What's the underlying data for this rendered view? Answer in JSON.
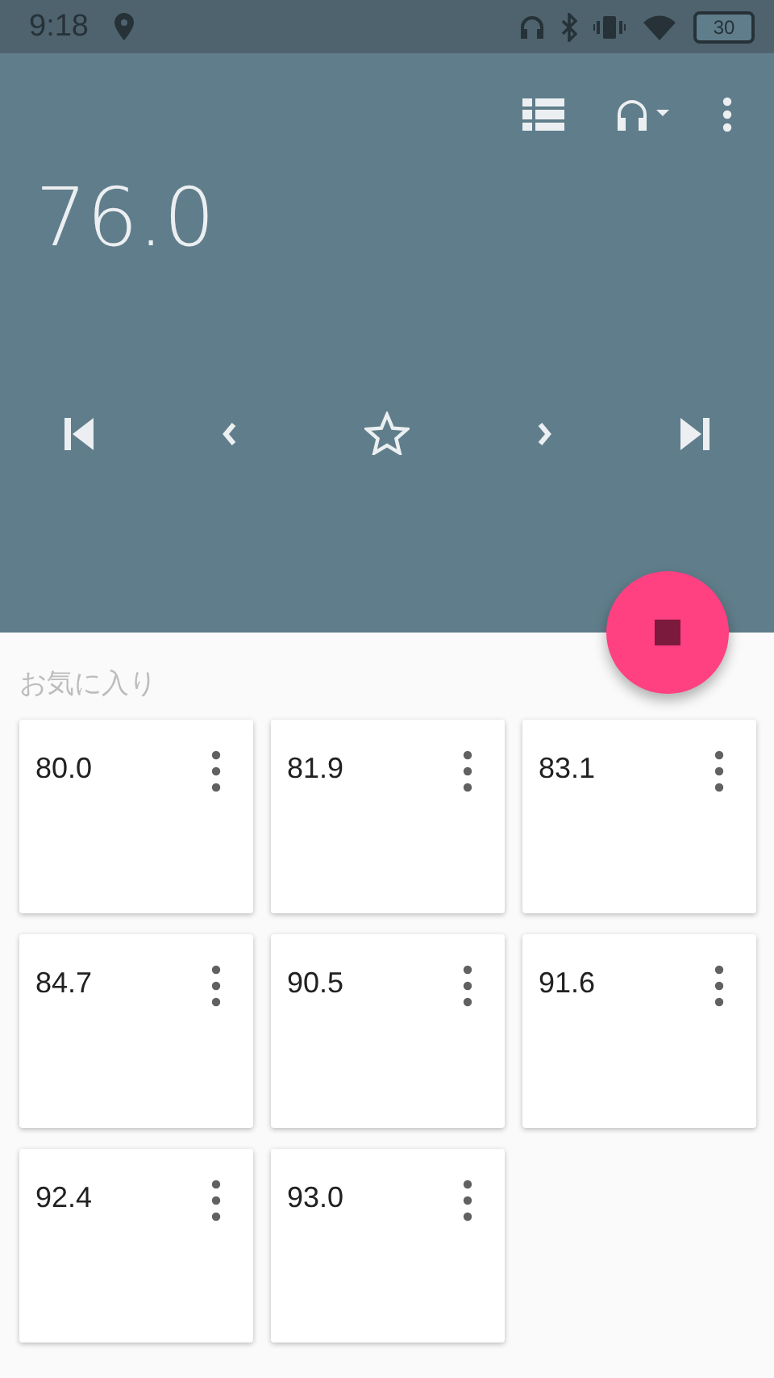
{
  "status_bar": {
    "time": "9:18",
    "battery": "30"
  },
  "station": {
    "frequency": "76.0",
    "favorite": false
  },
  "favorites": {
    "title": "お気に入り",
    "stations": [
      {
        "frequency": "80.0"
      },
      {
        "frequency": "81.9"
      },
      {
        "frequency": "83.1"
      },
      {
        "frequency": "84.7"
      },
      {
        "frequency": "90.5"
      },
      {
        "frequency": "91.6"
      },
      {
        "frequency": "92.4"
      },
      {
        "frequency": "93.0"
      }
    ]
  }
}
